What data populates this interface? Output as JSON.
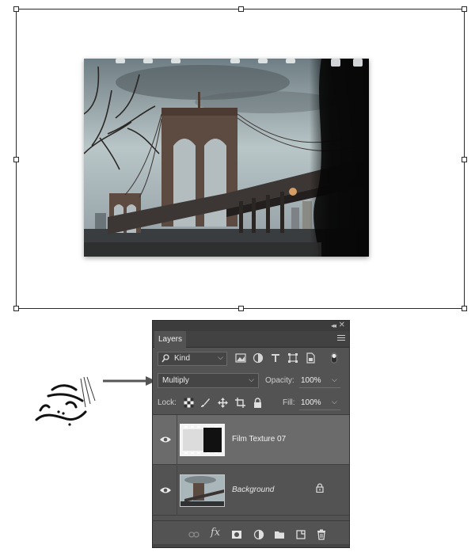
{
  "canvas": {
    "layer_preview": "film-texture-bridge-photo"
  },
  "layers_panel": {
    "tab_label": "Layers",
    "filter": {
      "kind_label": "Kind",
      "icons": [
        "image-filter-icon",
        "adjustment-filter-icon",
        "type-filter-icon",
        "shape-filter-icon",
        "smart-object-filter-icon",
        "filter-toggle-icon"
      ]
    },
    "blend_mode": "Multiply",
    "opacity_label": "Opacity:",
    "opacity_value": "100%",
    "lock_label": "Lock:",
    "lock_icons": [
      "lock-transparent-icon",
      "lock-image-icon",
      "lock-position-icon",
      "lock-artboard-icon",
      "lock-all-icon"
    ],
    "fill_label": "Fill:",
    "fill_value": "100%",
    "layers": [
      {
        "name": "Film Texture 07",
        "visible": true,
        "selected": true
      },
      {
        "name": "Background",
        "visible": true,
        "locked": true
      }
    ],
    "bottom_icons": [
      "link-layers-icon",
      "fx-icon",
      "layer-mask-icon",
      "adjustment-layer-icon",
      "group-folder-icon",
      "new-layer-icon",
      "trash-icon"
    ]
  },
  "annotation": {
    "pointer": "arrow-pointing-to-blend-mode"
  },
  "colors": {
    "panel_bg": "#535353",
    "selected_row": "#6b6b6b",
    "panel_header": "#424242"
  }
}
